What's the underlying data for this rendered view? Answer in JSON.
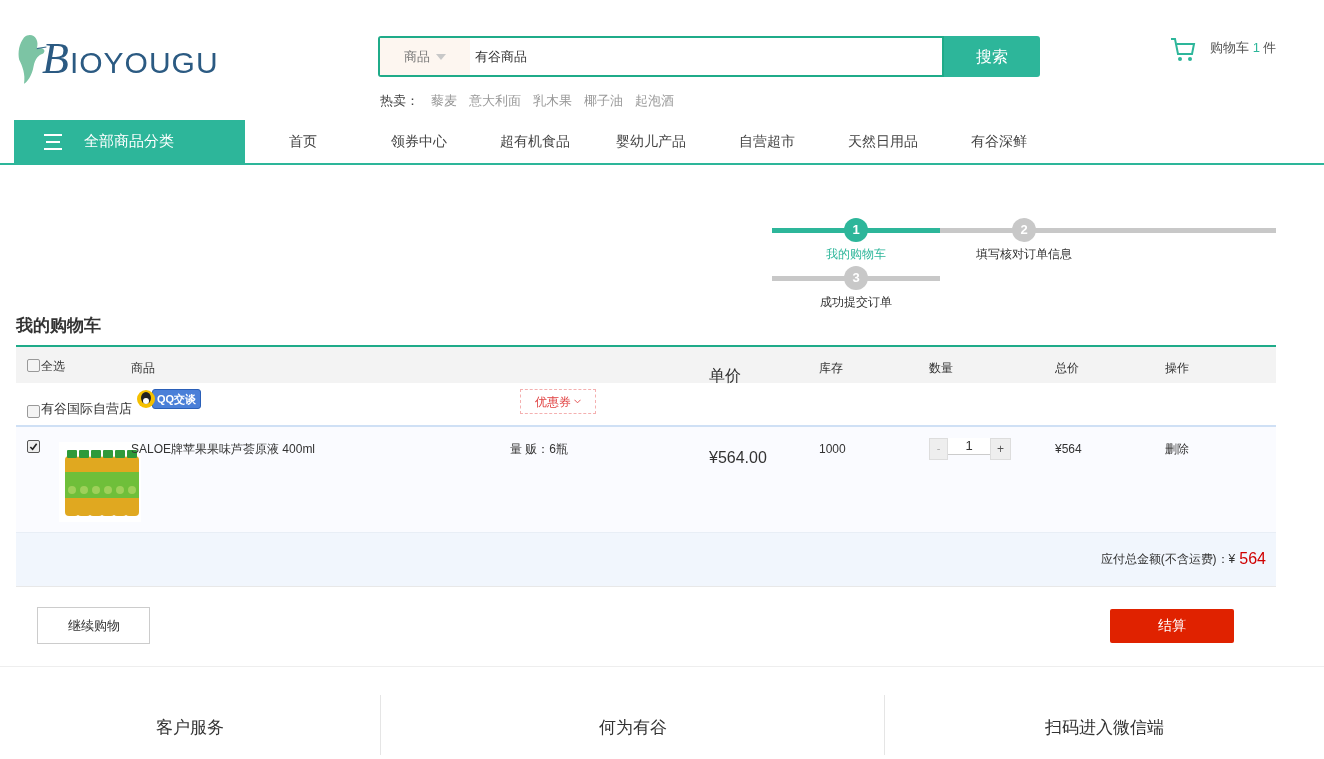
{
  "logo": {
    "text": "BIOYOUGU"
  },
  "search": {
    "scope": "商品",
    "value": "有谷商品",
    "button": "搜索",
    "hot_label": "热卖：",
    "hot": [
      "藜麦",
      "意大利面",
      "乳木果",
      "椰子油",
      "起泡酒"
    ]
  },
  "cart_link": {
    "label": "购物车",
    "count": "1",
    "unit": "件"
  },
  "nav": {
    "all": "全部商品分类",
    "items": [
      {
        "label": "首页",
        "selected": false
      },
      {
        "label": "领券中心",
        "selected": false
      },
      {
        "label": "超有机食品",
        "selected": false
      },
      {
        "label": "婴幼儿产品",
        "selected": false
      },
      {
        "label": "自营超市",
        "selected": false
      },
      {
        "label": "天然日用品",
        "selected": false
      },
      {
        "label": "有谷深鲜",
        "selected": false
      }
    ]
  },
  "steps": [
    {
      "number": "1",
      "label": "我的购物车",
      "selected": true
    },
    {
      "number": "2",
      "label": "填写核对订单信息",
      "selected": false
    },
    {
      "number": "3",
      "label": "成功提交订单",
      "selected": false
    }
  ],
  "cart": {
    "title": "我的购物车",
    "select_all": {
      "label": "全选",
      "checked": false
    },
    "columns": [
      "商品",
      "单价",
      "库存",
      "数量",
      "总价",
      "操作"
    ],
    "store": {
      "name": "有谷国际自营店",
      "checked": false,
      "chat": "QQ交谈",
      "coupon": "优惠券"
    },
    "items": [
      {
        "checked": true,
        "name": "SALOE牌苹果果味芦荟原液 400ml",
        "spec": "量 贩：6瓶",
        "price": "¥564.00",
        "stock": "1000",
        "minus": "-",
        "quantity": "1",
        "plus": "+",
        "total": "¥564",
        "action": "删除"
      }
    ],
    "total_label": "应付总金额(不含运费)：¥",
    "total": "564",
    "continue": "继续购物",
    "checkout": "结算"
  },
  "footer": [
    "客户服务",
    "何为有谷",
    "扫码进入微信端"
  ]
}
